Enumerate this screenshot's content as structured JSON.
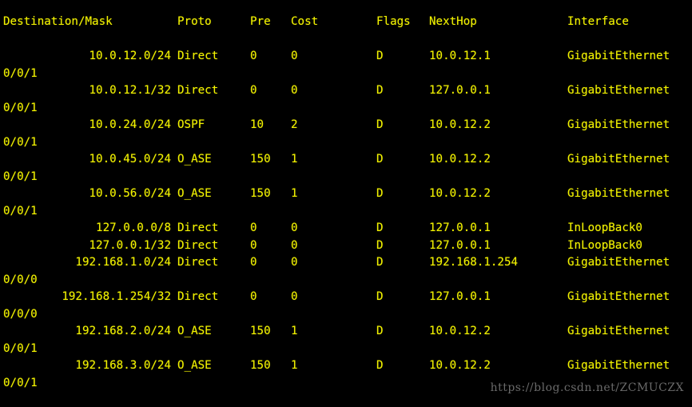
{
  "terminal": {
    "background_color": "#000000",
    "text_color": "#f2f200",
    "watermark_color": "#6a6a6a"
  },
  "headers": {
    "destination": "Destination/Mask",
    "proto": "Proto",
    "pre": "Pre",
    "cost": "Cost",
    "flags": "Flags",
    "nexthop": "NextHop",
    "interface": "Interface"
  },
  "rows": [
    {
      "destination": "10.0.12.0/24",
      "proto": "Direct",
      "pre": "0",
      "cost": "0",
      "flags": "D",
      "nexthop": "10.0.12.1",
      "interface": "GigabitEthernet",
      "interface_wrap": "0/0/1"
    },
    {
      "destination": "10.0.12.1/32",
      "proto": "Direct",
      "pre": "0",
      "cost": "0",
      "flags": "D",
      "nexthop": "127.0.0.1",
      "interface": "GigabitEthernet",
      "interface_wrap": "0/0/1"
    },
    {
      "destination": "10.0.24.0/24",
      "proto": "OSPF",
      "pre": "10",
      "cost": "2",
      "flags": "D",
      "nexthop": "10.0.12.2",
      "interface": "GigabitEthernet",
      "interface_wrap": "0/0/1"
    },
    {
      "destination": "10.0.45.0/24",
      "proto": "O_ASE",
      "pre": "150",
      "cost": "1",
      "flags": "D",
      "nexthop": "10.0.12.2",
      "interface": "GigabitEthernet",
      "interface_wrap": "0/0/1"
    },
    {
      "destination": "10.0.56.0/24",
      "proto": "O_ASE",
      "pre": "150",
      "cost": "1",
      "flags": "D",
      "nexthop": "10.0.12.2",
      "interface": "GigabitEthernet",
      "interface_wrap": "0/0/1"
    },
    {
      "destination": "127.0.0.0/8",
      "proto": "Direct",
      "pre": "0",
      "cost": "0",
      "flags": "D",
      "nexthop": "127.0.0.1",
      "interface": "InLoopBack0",
      "interface_wrap": ""
    },
    {
      "destination": "127.0.0.1/32",
      "proto": "Direct",
      "pre": "0",
      "cost": "0",
      "flags": "D",
      "nexthop": "127.0.0.1",
      "interface": "InLoopBack0",
      "interface_wrap": ""
    },
    {
      "destination": "192.168.1.0/24",
      "proto": "Direct",
      "pre": "0",
      "cost": "0",
      "flags": "D",
      "nexthop": "192.168.1.254",
      "interface": "GigabitEthernet",
      "interface_wrap": "0/0/0"
    },
    {
      "destination": "192.168.1.254/32",
      "proto": "Direct",
      "pre": "0",
      "cost": "0",
      "flags": "D",
      "nexthop": "127.0.0.1",
      "interface": "GigabitEthernet",
      "interface_wrap": "0/0/0"
    },
    {
      "destination": "192.168.2.0/24",
      "proto": "O_ASE",
      "pre": "150",
      "cost": "1",
      "flags": "D",
      "nexthop": "10.0.12.2",
      "interface": "GigabitEthernet",
      "interface_wrap": "0/0/1"
    },
    {
      "destination": "192.168.3.0/24",
      "proto": "O_ASE",
      "pre": "150",
      "cost": "1",
      "flags": "D",
      "nexthop": "10.0.12.2",
      "interface": "GigabitEthernet",
      "interface_wrap": "0/0/1"
    }
  ],
  "watermark": "https://blog.csdn.net/ZCMUCZX"
}
